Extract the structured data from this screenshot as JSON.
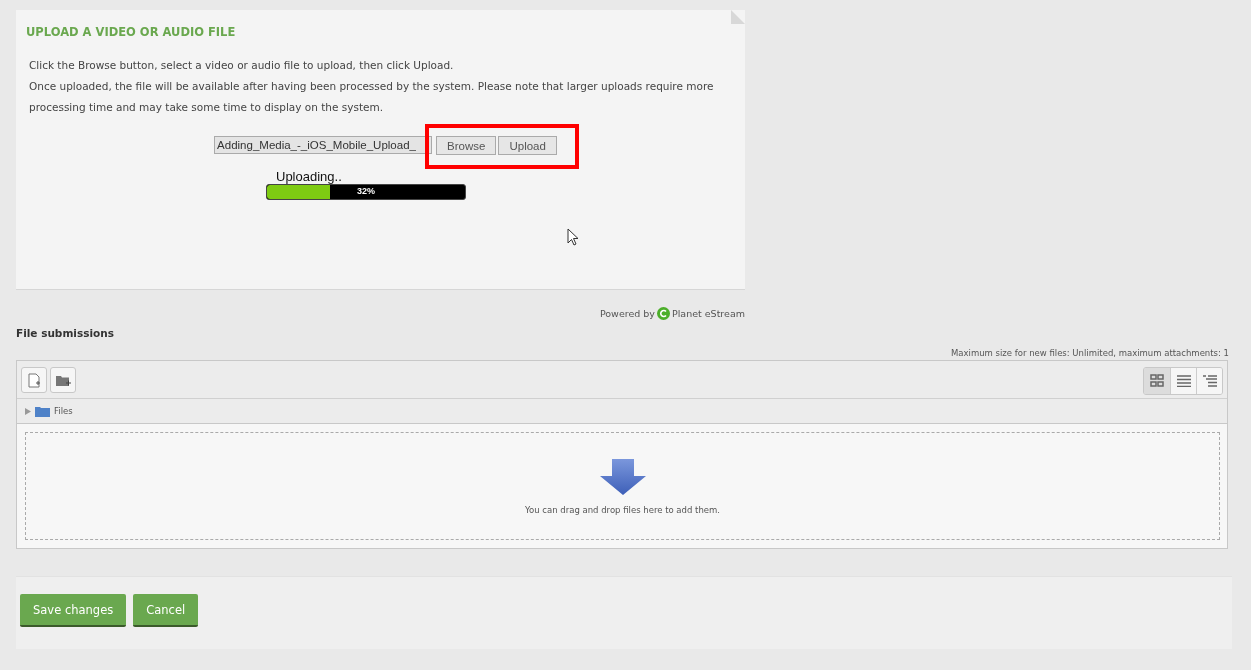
{
  "upload_panel": {
    "title": "UPLOAD A VIDEO OR AUDIO FILE",
    "instructions": [
      "Click the Browse button, select a video or audio file to upload, then click Upload.",
      "Once uploaded, the file will be available after having been processed by the system. Please note that larger uploads require more processing time and may take some time to display on the system."
    ],
    "file_field": {
      "value": "Adding_Media_-_iOS_Mobile_Upload_"
    },
    "buttons": [
      "Browse",
      "Upload"
    ],
    "highlighted": true,
    "progress": {
      "label": "Uploading..",
      "level": 0.32,
      "reading": "32%"
    }
  },
  "powered_by": {
    "prefix": "Powered by",
    "brand": "Planet eStream"
  },
  "file_submissions": {
    "label": "File submissions",
    "limits": "Maximum size for new files: Unlimited, maximum attachments: 1",
    "views": [
      {
        "kind": "icons",
        "selected": true
      },
      {
        "kind": "list",
        "selected": false
      },
      {
        "kind": "tree",
        "selected": false
      }
    ],
    "path": "Files",
    "drop_hint": "You can drag and drop files here to add them."
  },
  "actions": [
    "Save changes",
    "Cancel"
  ]
}
